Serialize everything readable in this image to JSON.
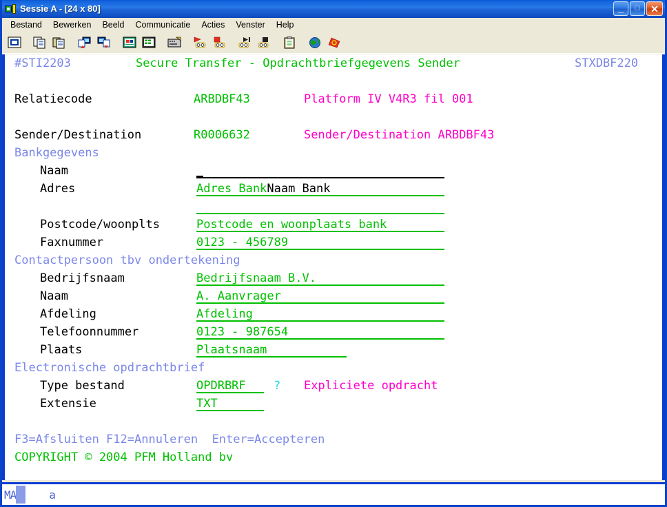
{
  "window": {
    "title": "Sessie A - [24 x 80]",
    "icon": "session-terminal-icon",
    "buttons": {
      "minimize": "_",
      "maximize": "□",
      "close": "✕"
    }
  },
  "menubar": {
    "items": [
      {
        "label": "Bestand",
        "name": "menu-bestand"
      },
      {
        "label": "Bewerken",
        "name": "menu-bewerken"
      },
      {
        "label": "Beeld",
        "name": "menu-beeld"
      },
      {
        "label": "Communicatie",
        "name": "menu-communicatie"
      },
      {
        "label": "Acties",
        "name": "menu-acties"
      },
      {
        "label": "Venster",
        "name": "menu-venster"
      },
      {
        "label": "Help",
        "name": "menu-help"
      }
    ]
  },
  "toolbar": {
    "buttons": [
      {
        "name": "display-session-icon",
        "title": "Beeldscherm"
      },
      {
        "name": "copy-icon",
        "title": "Kopiëren"
      },
      {
        "name": "paste-icon",
        "title": "Plakken"
      },
      {
        "name": "send-file-icon",
        "title": "Bestand verzenden"
      },
      {
        "name": "receive-file-icon",
        "title": "Bestand ontvangen"
      },
      {
        "name": "display-setup-icon",
        "title": "Beeldscherminstellingen"
      },
      {
        "name": "spreadsheet-icon",
        "title": "Gegevensoverdracht"
      },
      {
        "name": "keyboard-setup-icon",
        "title": "Toetsenbordinstelling"
      },
      {
        "name": "record-macro-icon",
        "title": "Macro opnemen"
      },
      {
        "name": "stop-macro-icon",
        "title": "Opname stoppen"
      },
      {
        "name": "play-macro-icon",
        "title": "Macro afspelen"
      },
      {
        "name": "stop-playback-icon",
        "title": "Afspelen stoppen"
      },
      {
        "name": "clipboard-icon",
        "title": "Klembord"
      },
      {
        "name": "globe-icon",
        "title": "Internet"
      },
      {
        "name": "pencil-note-icon",
        "title": "Notities"
      }
    ]
  },
  "screen": {
    "header": {
      "program_id": "#STI2203",
      "title": "Secure Transfer - Opdrachtbriefgegevens Sender",
      "screen_id": "STXDBF220"
    },
    "relatiecode": {
      "label": "Relatiecode",
      "value": "ARBDBF43",
      "platform": "Platform IV V4R3 fil 001"
    },
    "sender_destination": {
      "label": "Sender/Destination",
      "value": "R0006632",
      "right_label": "Sender/Destination ARBDBF43"
    },
    "sections": {
      "bankgegevens": "Bankgegevens",
      "contactpersoon": "Contactpersoon tbv ondertekening",
      "electronische": "Electronische opdrachtbrief"
    },
    "bank_fields": [
      {
        "label": "Naam",
        "value": "Naam Bank",
        "active": true
      },
      {
        "label": "Adres",
        "value": "Adres Bank",
        "active": false
      },
      {
        "label": "",
        "value": "",
        "active": false
      },
      {
        "label": "Postcode/woonplts",
        "value": "Postcode en woonplaats bank",
        "active": false
      },
      {
        "label": "Faxnummer",
        "value": "0123 - 456789",
        "active": false
      }
    ],
    "contact_fields": [
      {
        "label": "Bedrijfsnaam",
        "value": "Bedrijfsnaam B.V."
      },
      {
        "label": "Naam",
        "value": "A. Aanvrager"
      },
      {
        "label": "Afdeling",
        "value": "Afdeling"
      },
      {
        "label": "Telefoonnummer",
        "value": "0123 - 987654"
      },
      {
        "label": "Plaats",
        "value": "Plaatsnaam"
      }
    ],
    "file_fields": {
      "type_label": "Type bestand",
      "type_value": "OPDRBRF",
      "type_prompt": "?",
      "type_note": "Expliciete opdracht",
      "ext_label": "Extensie",
      "ext_value": "TXT"
    },
    "function_keys": "F3=Afsluiten F12=Annuleren  Enter=Accepteren",
    "copyright": "COPYRIGHT © 2004 PFM Holland bv"
  },
  "statusbar": {
    "mode": "MA",
    "indicator": "a"
  },
  "colors": {
    "green": "#00c000",
    "blue": "#7b87e8",
    "pink": "#ff00c8",
    "cyan": "#24d8e8",
    "black": "#000000",
    "frame_blue": "#0a3cd2",
    "title_blue": "#1464e0"
  }
}
